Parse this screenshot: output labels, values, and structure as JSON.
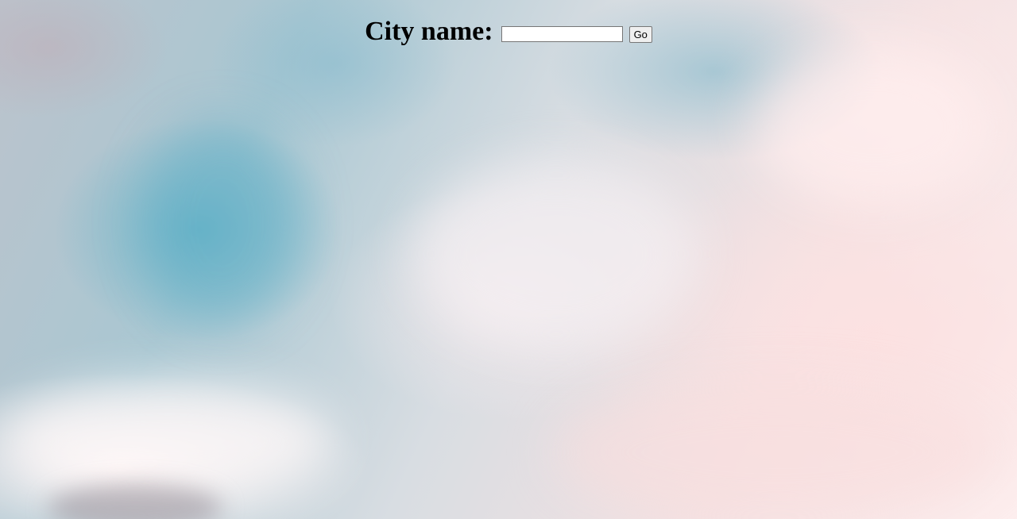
{
  "form": {
    "label": "City name:",
    "input_value": "",
    "input_placeholder": "",
    "submit_label": "Go"
  },
  "background": {
    "image": "sky-with-clouds",
    "colors": [
      "#a9c7d2",
      "#60b2c8",
      "#f4e2e3",
      "#fdeeee"
    ]
  }
}
